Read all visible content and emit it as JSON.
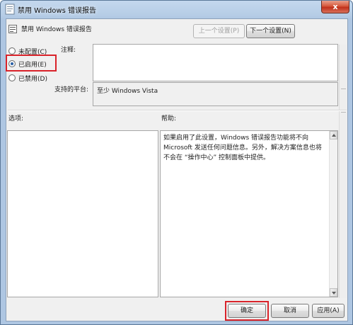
{
  "window": {
    "title": "禁用 Windows 错误报告",
    "close_label": "x"
  },
  "header": {
    "setting_title": "禁用 Windows 错误报告",
    "prev_button": "上一个设置(P)",
    "next_button": "下一个设置(N)"
  },
  "state": {
    "options": [
      {
        "label": "未配置(C)",
        "checked": false
      },
      {
        "label": "已启用(E)",
        "checked": true
      },
      {
        "label": "已禁用(D)",
        "checked": false
      }
    ]
  },
  "fields": {
    "comment_label": "注释:",
    "comment_value": "",
    "platform_label": "支持的平台:",
    "platform_value": "至少 Windows Vista"
  },
  "panes": {
    "options_label": "选项:",
    "help_label": "帮助:",
    "help_text": "如果启用了此设置，Windows 错误报告功能将不向 Microsoft 发送任何问题信息。另外，解决方案信息也将不会在 “操作中心” 控制面板中提供。"
  },
  "footer": {
    "ok_button": "确定",
    "cancel_button": "取消",
    "apply_button": "应用(A)"
  },
  "colors": {
    "highlight": "#d9232a",
    "titlebar": "#b6cde6",
    "client_bg": "#f0f0f0"
  }
}
